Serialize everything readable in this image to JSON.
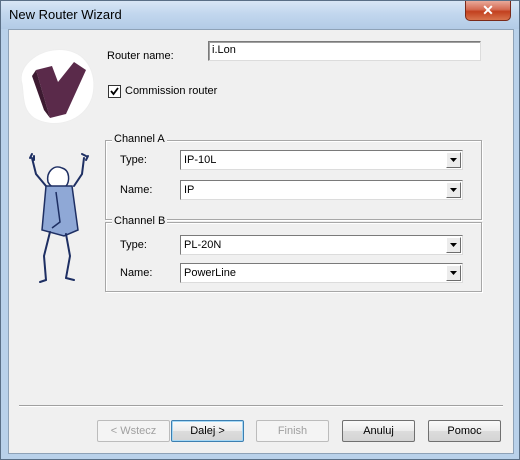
{
  "window": {
    "title": "New Router Wizard"
  },
  "router": {
    "name_label": "Router name:",
    "name_value": "i.Lon",
    "commission_label": "Commission router",
    "commission_checked": true
  },
  "channel_a": {
    "legend": "Channel A",
    "type_label": "Type:",
    "type_value": "IP-10L",
    "name_label": "Name:",
    "name_value": "IP"
  },
  "channel_b": {
    "legend": "Channel B",
    "type_label": "Type:",
    "type_value": "PL-20N",
    "name_label": "Name:",
    "name_value": "PowerLine"
  },
  "buttons": {
    "back": "< Wstecz",
    "next": "Dalej >",
    "finish": "Finish",
    "cancel": "Anuluj",
    "help": "Pomoc"
  },
  "icons": {
    "close": "close-icon",
    "checkmark": "checkmark-icon",
    "dropdown": "chevron-down-icon",
    "logo": "wizard-logo-icon",
    "figure": "cheering-figure-illustration"
  },
  "colors": {
    "title_bar": "#c2d7ee",
    "close_button": "#c2401e",
    "logo_purple": "#5a2a4a",
    "figure_blue": "#2a3f7a",
    "dialog_bg": "#f0f0f0"
  }
}
